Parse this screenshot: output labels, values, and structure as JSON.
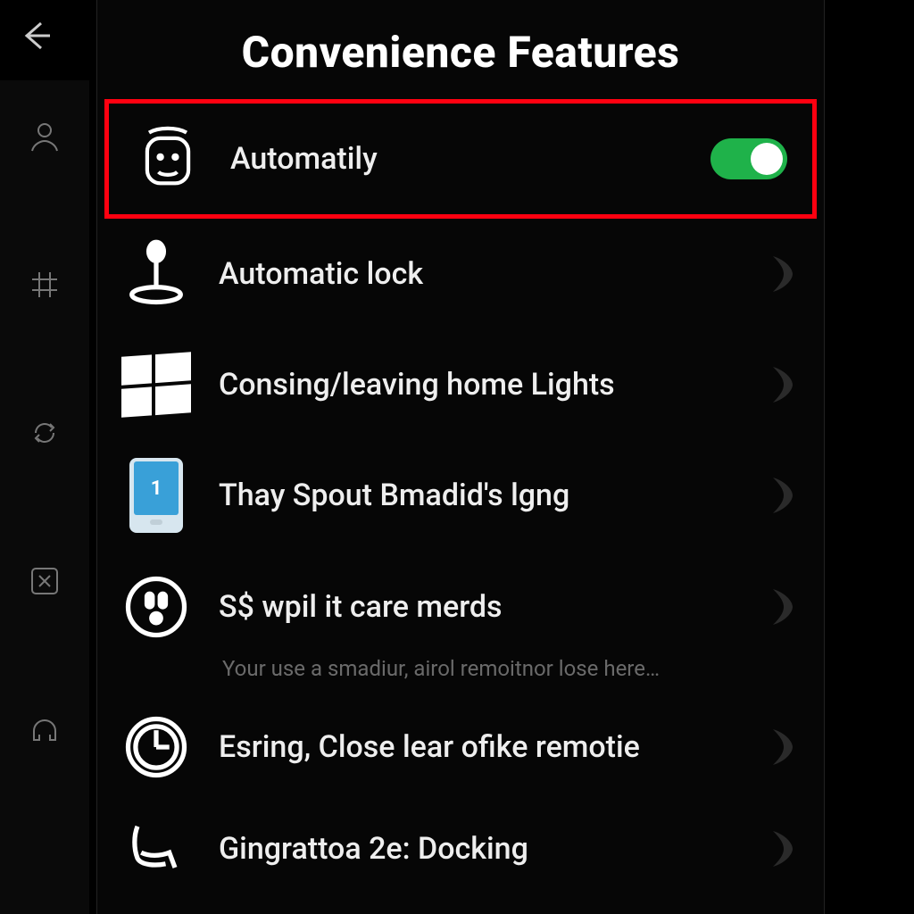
{
  "header": {
    "title": "Convenience Features"
  },
  "items": [
    {
      "label": "Automatily",
      "toggle_on": true,
      "highlighted": true
    },
    {
      "label": "Automatic lock"
    },
    {
      "label": "Consing/leaving home Lights"
    },
    {
      "label": "Thay Spout Bmadid's lgng"
    },
    {
      "label": "S$ wpil it care merds",
      "hint": "Your use a smadiur, airol remoitnor lose here…"
    },
    {
      "label": "Esring, Close lear ofike remotie"
    },
    {
      "label": "Gingrattoa 2e: Docking"
    }
  ],
  "colors": {
    "accent_green": "#1fb24a",
    "highlight_red": "#ff0010"
  }
}
